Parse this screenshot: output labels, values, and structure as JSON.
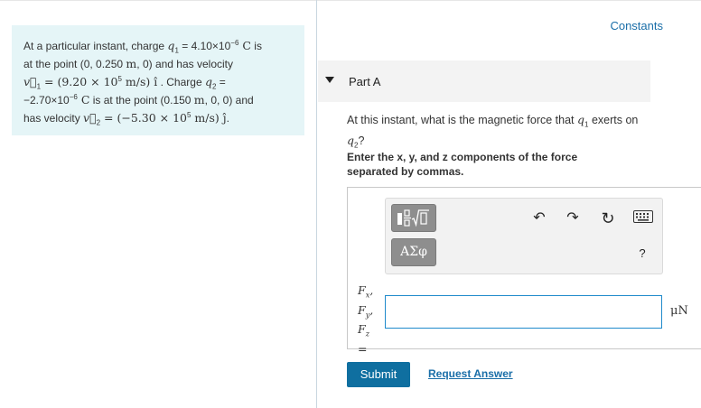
{
  "header": {
    "constants_link": "Constants"
  },
  "problem": {
    "l1_a": "At a particular instant, charge ",
    "q1": "q",
    "q1_sub": "1",
    "l1_b": " = 4.10×10",
    "l1_exp": "−6",
    "l1_unit": " C",
    "l1_c": " is",
    "l2_a": "at the point (0, 0.250 ",
    "l2_m": "m",
    "l2_b": ", 0) and has velocity",
    "l3_v": "v⃗",
    "l3_vsub": "1",
    "l3_eq": " = (9.20 × 10",
    "l3_exp": "5",
    "l3_units": " m/s) ",
    "l3_hat": "î",
    "l3_b": " . Charge ",
    "l3_q": "q",
    "l3_qsub": "2",
    "l3_c": " =",
    "l4_a": "−2.70×10",
    "l4_exp": "−6",
    "l4_unit": " C",
    "l4_b": " is at the point (0.150 ",
    "l4_m": "m",
    "l4_c": ", 0, 0) and",
    "l5_a": "has velocity ",
    "l5_v": "v⃗",
    "l5_vsub": "2",
    "l5_eq": " = (−5.30 × 10",
    "l5_exp": "5",
    "l5_units": " m/s) ",
    "l5_hat": "ĵ",
    "l5_b": "."
  },
  "part": {
    "title": "Part A"
  },
  "question": {
    "a": "At this instant, what is the magnetic force that ",
    "q": "q",
    "qsub": "1",
    "b": " exerts on",
    "q2": "q",
    "q2sub": "2",
    "c": "?"
  },
  "instructions": "Enter the x, y, and z components of the force separated by commas.",
  "toolbar": {
    "greek_label": "ΑΣφ",
    "help_label": "?",
    "undo_icon": "↶",
    "redo_icon": "↷",
    "reset_icon": "↻"
  },
  "answer": {
    "var_f": "F",
    "sub_x": "x",
    "sub_y": "y",
    "sub_z": "z",
    "comma": ",",
    "equals": "=",
    "value": "",
    "unit": "μN"
  },
  "actions": {
    "submit_label": "Submit",
    "request_label": "Request Answer"
  }
}
